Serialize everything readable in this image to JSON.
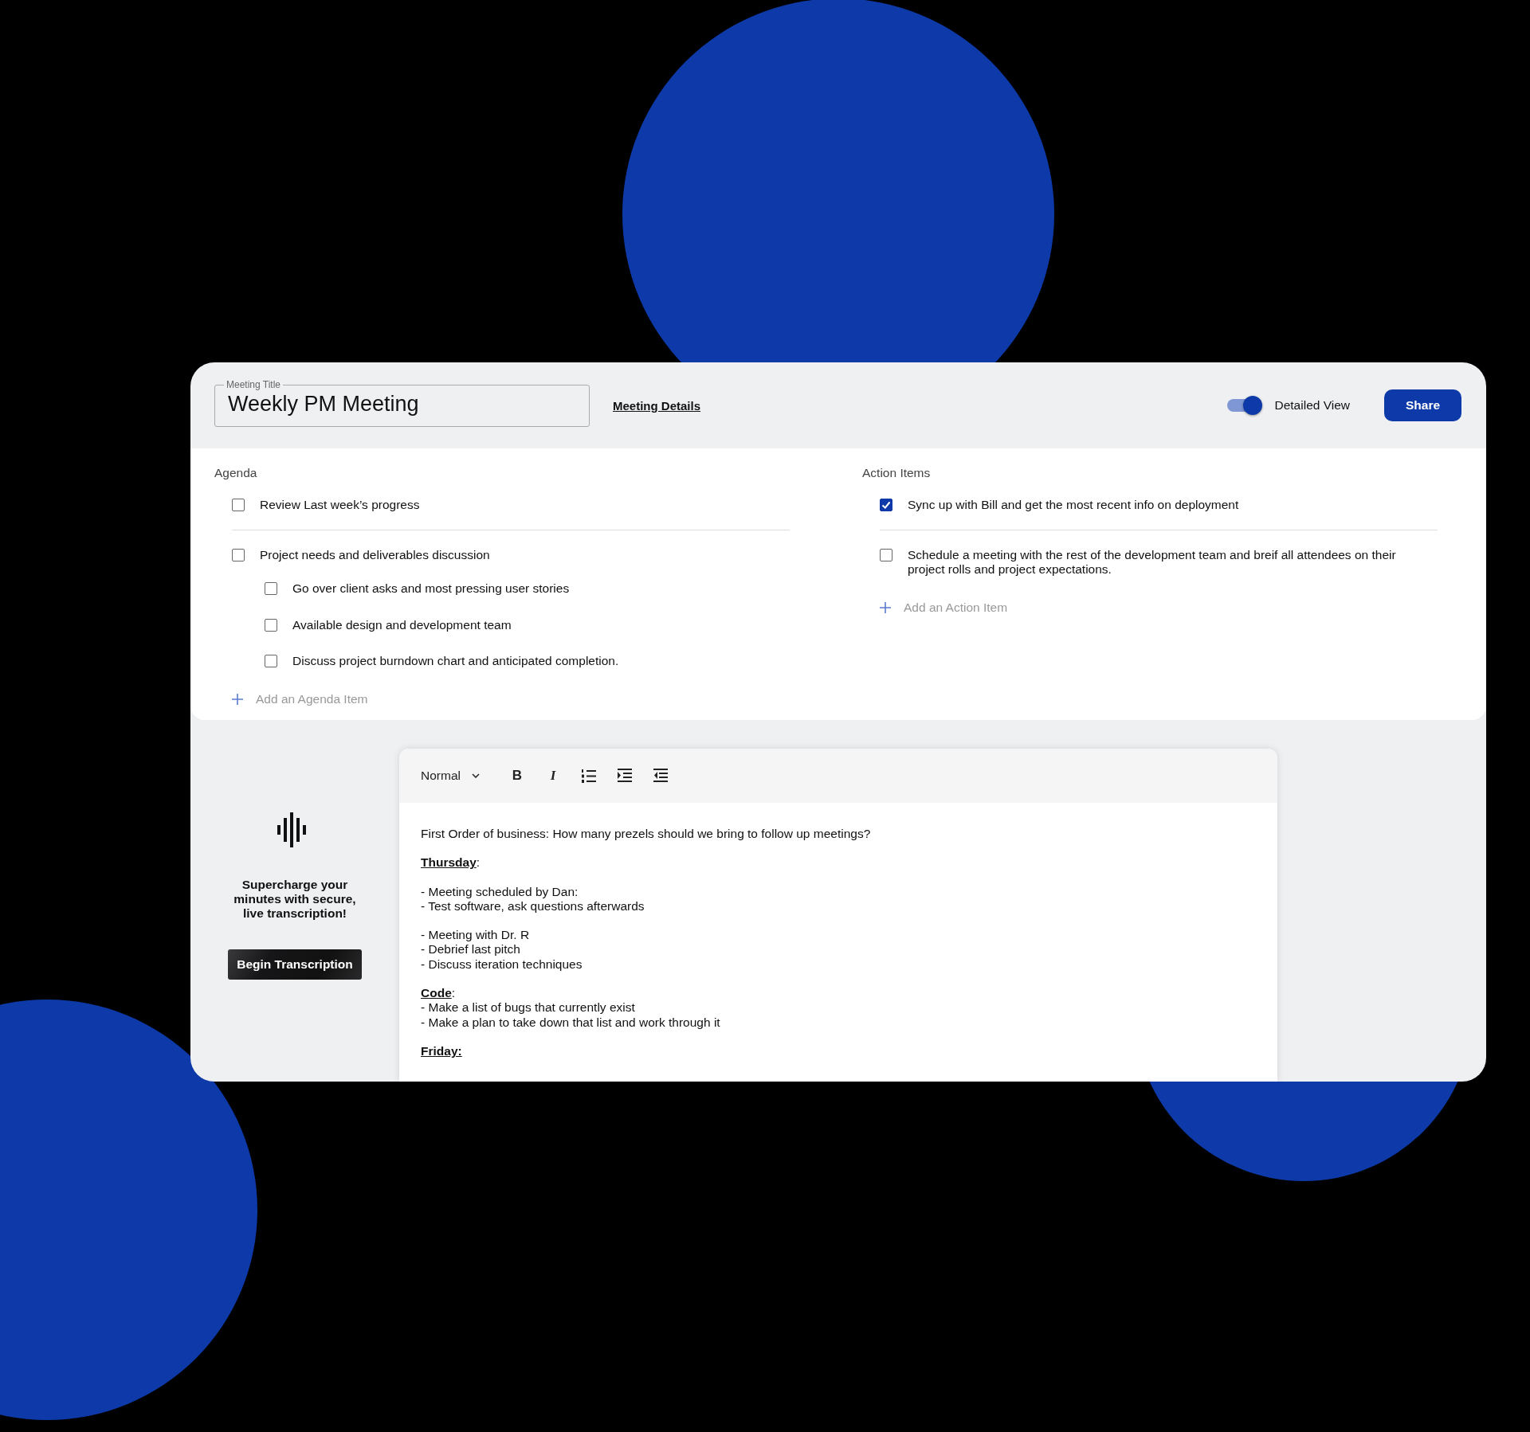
{
  "header": {
    "title_field": {
      "label": "Meeting Title",
      "value": "Weekly PM Meeting"
    },
    "details_link": "Meeting Details",
    "detailed_view": {
      "label": "Detailed View",
      "on": true
    },
    "share_button": "Share"
  },
  "agenda": {
    "title": "Agenda",
    "items": [
      {
        "text": "Review Last week’s progress",
        "checked": false
      },
      {
        "text": "Project needs and deliverables discussion",
        "checked": false,
        "children": [
          {
            "text": "Go over client asks and most pressing user stories",
            "checked": false
          },
          {
            "text": "Available design and development team",
            "checked": false
          },
          {
            "text": "Discuss project burndown chart and anticipated completion.",
            "checked": false
          }
        ]
      }
    ],
    "add_label": "Add an Agenda Item"
  },
  "action_items": {
    "title": "Action Items",
    "items": [
      {
        "text": "Sync up with Bill and get the most recent info on deployment",
        "checked": true
      },
      {
        "text": "Schedule a meeting with the rest of the development team and breif all attendees on their project rolls and project expectations.",
        "checked": false
      }
    ],
    "add_label": "Add an Action Item"
  },
  "transcription": {
    "message": "Supercharge your minutes with secure, live transcription!",
    "button": "Begin Transcription"
  },
  "editor": {
    "toolbar": {
      "style_select": "Normal",
      "buttons": [
        {
          "kind": "bold",
          "label": "B"
        },
        {
          "kind": "italic",
          "label": "I"
        },
        {
          "kind": "ordered-list"
        },
        {
          "kind": "indent"
        },
        {
          "kind": "outdent"
        }
      ]
    },
    "blocks": [
      {
        "lines": [
          {
            "kind": "text",
            "text": "First Order of business: How many prezels should we bring to follow up meetings?"
          }
        ]
      },
      {
        "lines": [
          {
            "kind": "heading",
            "text": "Thursday",
            "after": ":"
          }
        ]
      },
      {
        "lines": [
          {
            "kind": "text",
            "text": "- Meeting scheduled by Dan:"
          },
          {
            "kind": "text",
            "text": "- Test software, ask questions afterwards"
          }
        ]
      },
      {
        "lines": [
          {
            "kind": "text",
            "text": "- Meeting with Dr. R"
          },
          {
            "kind": "text",
            "text": "- Debrief last pitch"
          },
          {
            "kind": "text",
            "text": "- Discuss iteration techniques"
          }
        ]
      },
      {
        "lines": [
          {
            "kind": "heading",
            "text": "Code",
            "after": ":"
          },
          {
            "kind": "text",
            "text": "- Make a list of bugs that currently exist"
          },
          {
            "kind": "text",
            "text": "- Make a plan to take down that list and work through it"
          }
        ]
      },
      {
        "lines": [
          {
            "kind": "heading",
            "text": "Friday:"
          }
        ]
      }
    ]
  }
}
